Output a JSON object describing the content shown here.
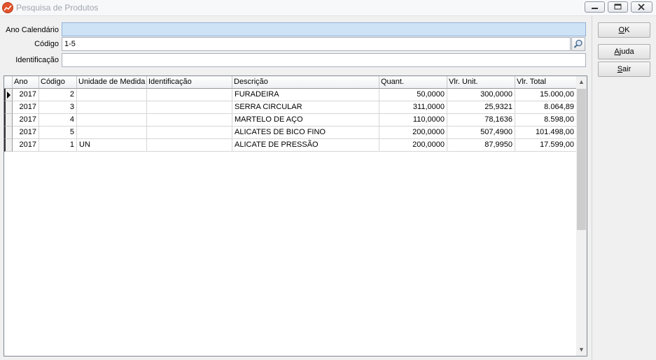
{
  "window": {
    "title": "Pesquisa de Produtos",
    "controls": [
      "minimize-icon",
      "restore-icon",
      "close-icon"
    ]
  },
  "form": {
    "ano_label": "Ano Calendário",
    "ano_value": "",
    "codigo_label": "Código",
    "codigo_value": "1-5",
    "identificacao_label": "Identificação",
    "identificacao_value": "",
    "search_icon": "magnifier-icon"
  },
  "grid": {
    "columns": [
      "Ano",
      "Código",
      "Unidade de Medida",
      "Identificação",
      "Descrição",
      "Quant.",
      "Vlr. Unit.",
      "Vlr. Total"
    ],
    "rows": [
      [
        "2017",
        "2",
        "",
        "",
        "FURADEIRA",
        "50,0000",
        "300,0000",
        "15.000,00"
      ],
      [
        "2017",
        "3",
        "",
        "",
        "SERRA CIRCULAR",
        "311,0000",
        "25,9321",
        "8.064,89"
      ],
      [
        "2017",
        "4",
        "",
        "",
        "MARTELO DE AÇO",
        "110,0000",
        "78,1636",
        "8.598,00"
      ],
      [
        "2017",
        "5",
        "",
        "",
        "ALICATES DE BICO FINO",
        "200,0000",
        "507,4900",
        "101.498,00"
      ],
      [
        "2017",
        "1",
        "UN",
        "",
        "ALICATE DE PRESSÃO",
        "200,0000",
        "87,9950",
        "17.599,00"
      ]
    ]
  },
  "buttons": {
    "ok": {
      "mnemonic": "O",
      "rest": "K"
    },
    "ajuda": {
      "mnemonic": "A",
      "rest": "juda"
    },
    "sair": {
      "mnemonic": "S",
      "rest": "air"
    }
  },
  "colors": {
    "focused_field": "#cfe3f7",
    "app_icon": "#e2532c"
  }
}
